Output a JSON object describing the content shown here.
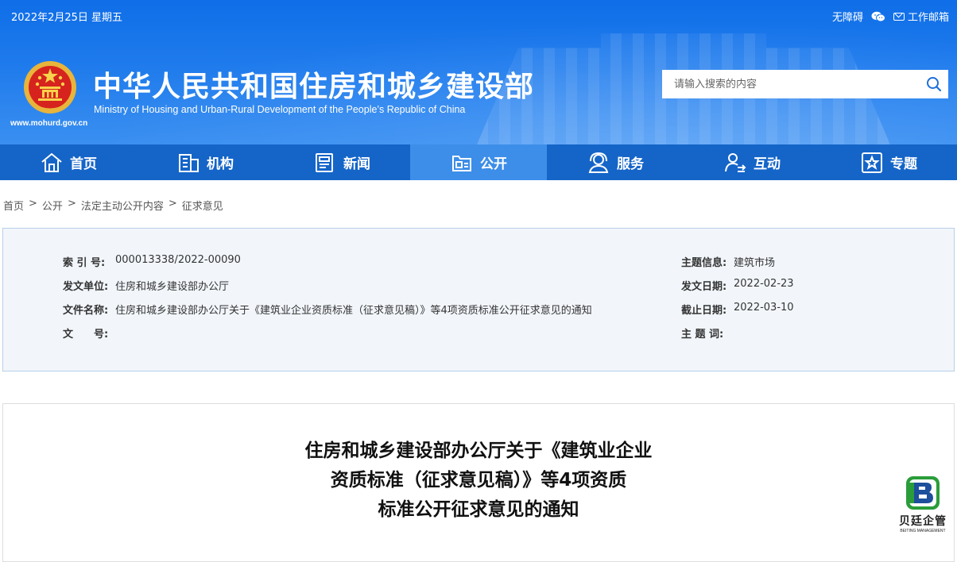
{
  "header": {
    "date": "2022年2月25日 星期五",
    "accessibility_label": "无障碍",
    "wechat_icon": "wechat-icon",
    "mail_label": "工作邮箱",
    "site_title": "中华人民共和国住房和城乡建设部",
    "site_subtitle": "Ministry of Housing and Urban-Rural Development of the People’s Republic of China",
    "site_url": "www.mohurd.gov.cn",
    "search_placeholder": "请输入搜索的内容",
    "brand_color": "#1565c8"
  },
  "nav": {
    "items": [
      {
        "label": "首页",
        "icon": "home-icon"
      },
      {
        "label": "机构",
        "icon": "building-icon"
      },
      {
        "label": "新闻",
        "icon": "news-icon"
      },
      {
        "label": "公开",
        "icon": "disclosure-icon",
        "active": true
      },
      {
        "label": "服务",
        "icon": "service-icon"
      },
      {
        "label": "互动",
        "icon": "interaction-icon"
      },
      {
        "label": "专题",
        "icon": "topic-icon"
      }
    ]
  },
  "breadcrumb": [
    "首页",
    "公开",
    "法定主动公开内容",
    "征求意见"
  ],
  "info": {
    "index_label": "索 引 号:",
    "index_value": "000013338/2022-00090",
    "issuer_label": "发文单位:",
    "issuer_value": "住房和城乡建设部办公厅",
    "filename_label": "文件名称:",
    "filename_value": "住房和城乡建设部办公厅关于《建筑业企业资质标准（征求意见稿）》等4项资质标准公开征求意见的通知",
    "docno_label": "文　　号:",
    "docno_value": "",
    "topic_label": "主题信息:",
    "topic_value": "建筑市场",
    "date_label": "发文日期:",
    "date_value": "2022-02-23",
    "deadline_label": "截止日期:",
    "deadline_value": "2022-03-10",
    "keywords_label": "主 题 词:",
    "keywords_value": ""
  },
  "document": {
    "title_lines": [
      "住房和城乡建设部办公厅关于《建筑业企业",
      "资质标准（征求意见稿）》等4项资质",
      "标准公开征求意见的通知"
    ]
  },
  "watermark": {
    "name": "贝廷企管",
    "sub": "BEITING MANAGEMENT"
  }
}
